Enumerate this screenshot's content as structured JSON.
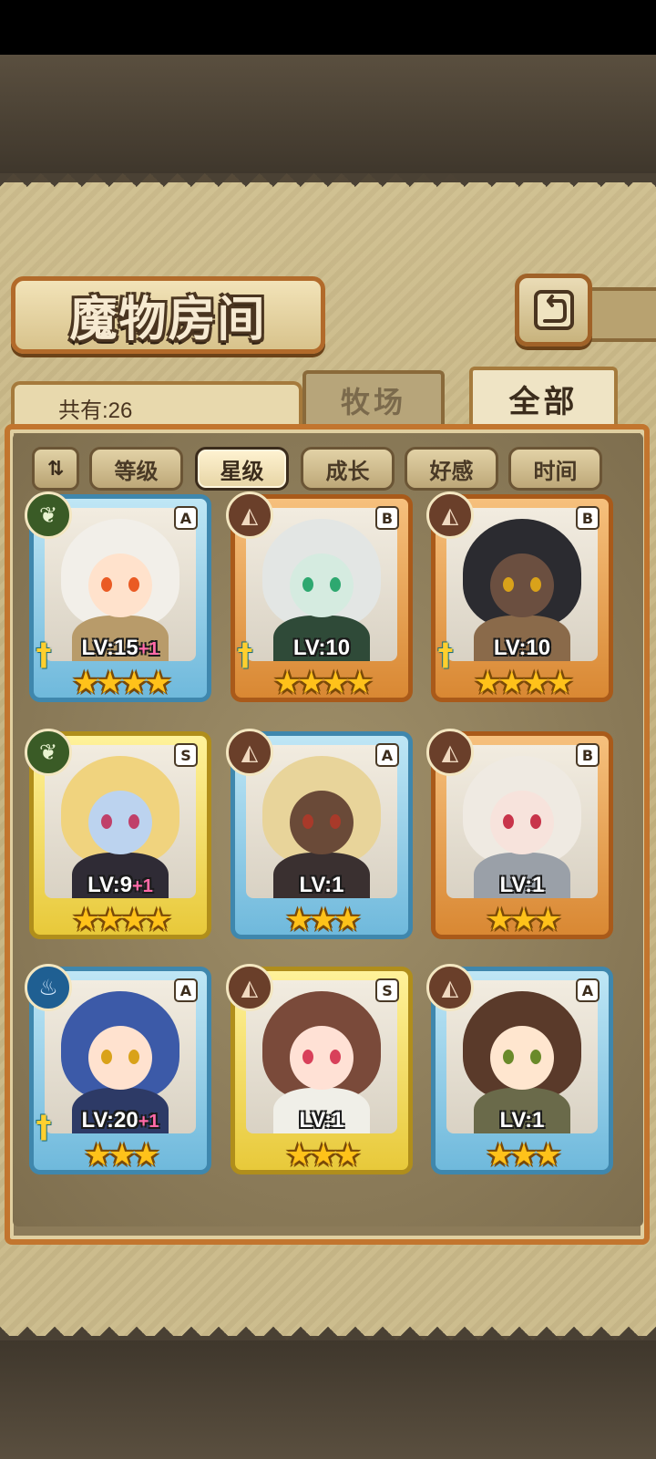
{
  "header": {
    "title": "魔物房间",
    "back_icon": "⮌"
  },
  "tabs": {
    "count_label": "共有:26",
    "ranch": "牧场",
    "all": "全部",
    "active": "all"
  },
  "filters": {
    "sort_toggle": "⇅",
    "items": [
      {
        "label": "等级",
        "active": false
      },
      {
        "label": "星级",
        "active": true
      },
      {
        "label": "成长",
        "active": false
      },
      {
        "label": "好感",
        "active": false
      },
      {
        "label": "时间",
        "active": false
      }
    ]
  },
  "monsters": [
    {
      "rarity": "A",
      "element": "plant",
      "element_icon": "❦",
      "frame": "blue",
      "level": "LV:15",
      "plus": "+1",
      "stars": "★★★★",
      "weapon": true
    },
    {
      "rarity": "B",
      "element": "earth",
      "element_icon": "◭",
      "frame": "orange",
      "level": "LV:10",
      "plus": "",
      "stars": "★★★★",
      "weapon": true
    },
    {
      "rarity": "B",
      "element": "earth",
      "element_icon": "◭",
      "frame": "orange",
      "level": "LV:10",
      "plus": "",
      "stars": "★★★★",
      "weapon": true
    },
    {
      "rarity": "S",
      "element": "plant",
      "element_icon": "❦",
      "frame": "yellow",
      "level": "LV:9",
      "plus": "+1",
      "stars": "★★★★",
      "weapon": false
    },
    {
      "rarity": "A",
      "element": "earth",
      "element_icon": "◭",
      "frame": "blue",
      "level": "LV:1",
      "plus": "",
      "stars": "★★★",
      "weapon": false
    },
    {
      "rarity": "B",
      "element": "earth",
      "element_icon": "◭",
      "frame": "orange",
      "level": "LV:1",
      "plus": "",
      "stars": "★★★",
      "weapon": false
    },
    {
      "rarity": "A",
      "element": "water",
      "element_icon": "♨",
      "frame": "blue",
      "level": "LV:20",
      "plus": "+1",
      "stars": "★★★",
      "weapon": true
    },
    {
      "rarity": "S",
      "element": "earth",
      "element_icon": "◭",
      "frame": "yellow",
      "level": "LV:1",
      "plus": "",
      "stars": "★★★",
      "weapon": false
    },
    {
      "rarity": "A",
      "element": "earth",
      "element_icon": "◭",
      "frame": "blue",
      "level": "LV:1",
      "plus": "",
      "stars": "★★★",
      "weapon": false
    }
  ],
  "colors": {
    "frame_blue": "#3f87ad",
    "frame_orange": "#a95a1a",
    "frame_yellow": "#b08e1b",
    "star": "#ffc21a",
    "plus": "#ff6aa8"
  }
}
